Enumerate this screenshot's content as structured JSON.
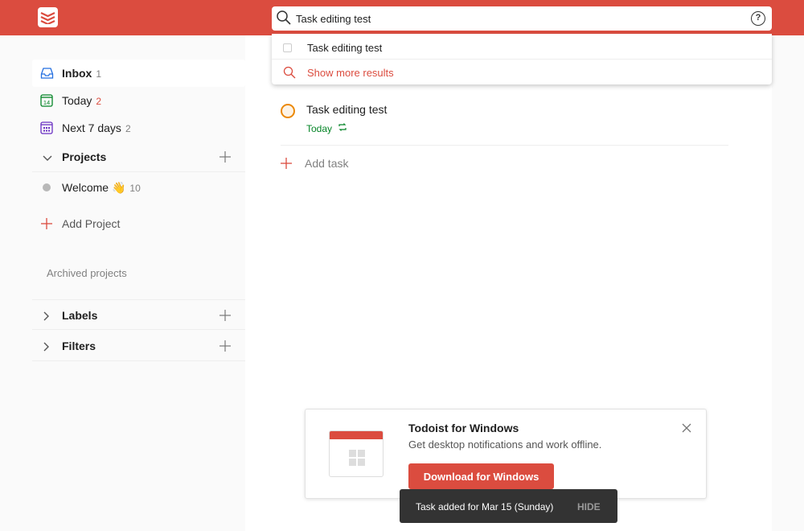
{
  "search": {
    "value": "Task editing test",
    "help_symbol": "?"
  },
  "dropdown": {
    "result": "Task editing test",
    "more": "Show more results"
  },
  "sidebar": {
    "items": [
      {
        "label": "Inbox",
        "count": "1",
        "icon": "inbox-icon"
      },
      {
        "label": "Today",
        "count": "2",
        "icon": "calendar-today-icon",
        "date_num": "14"
      },
      {
        "label": "Next 7 days",
        "count": "2",
        "icon": "calendar-week-icon"
      }
    ],
    "projects_label": "Projects",
    "project": {
      "label": "Welcome",
      "emoji": "👋",
      "count": "10"
    },
    "add_project": "Add Project",
    "archived": "Archived projects",
    "labels": "Labels",
    "filters": "Filters"
  },
  "main": {
    "task": {
      "title": "Task editing test",
      "date": "Today"
    },
    "add_task": "Add task"
  },
  "promo": {
    "title": "Todoist for Windows",
    "subtitle": "Get desktop notifications and work offline.",
    "button": "Download for Windows"
  },
  "toast": {
    "message": "Task added for Mar 15 (Sunday)",
    "hide": "HIDE"
  },
  "colors": {
    "brand": "#db4c3f",
    "today_green": "#058527",
    "priority_orange": "#eb8909"
  }
}
